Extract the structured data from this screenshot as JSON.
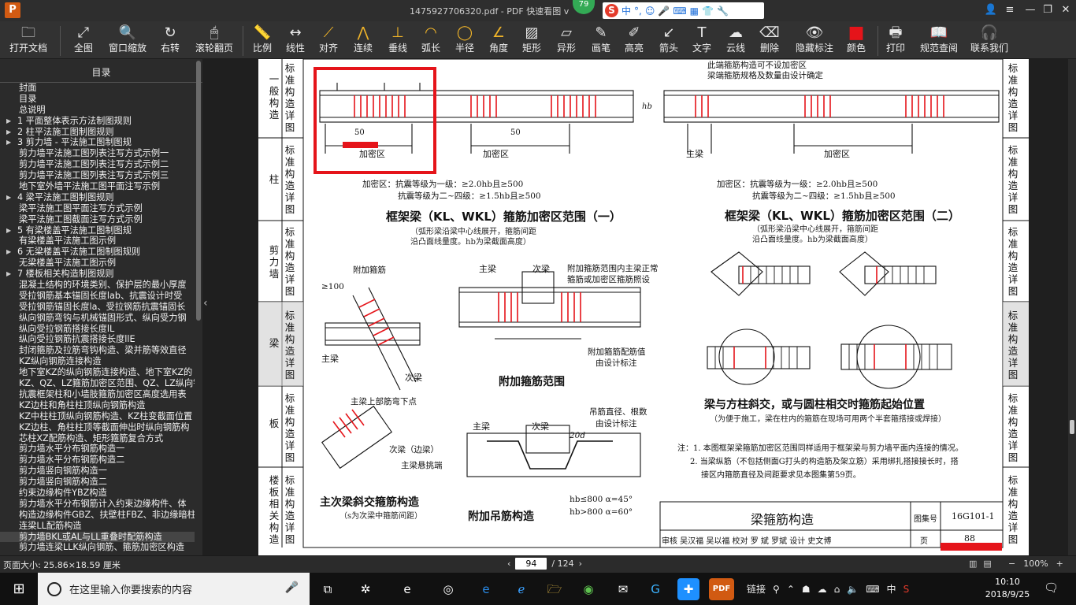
{
  "window": {
    "title": "1475927706320.pdf - PDF 快速看图 v",
    "badge": "79",
    "ime": {
      "lang": "中",
      "punct": "°,"
    }
  },
  "toolbar": [
    {
      "label": "打开文档",
      "icon": "folder-icon",
      "glyph": "🗀"
    },
    {
      "label": "全图",
      "icon": "fit-page-icon",
      "glyph": "⤢"
    },
    {
      "label": "窗口缩放",
      "icon": "zoom-window-icon",
      "glyph": "🔍"
    },
    {
      "label": "右转",
      "icon": "rotate-right-icon",
      "glyph": "↻"
    },
    {
      "label": "滚轮翻页",
      "icon": "mouse-wheel-icon",
      "glyph": "🖱"
    },
    {
      "label": "比例",
      "icon": "scale-icon",
      "glyph": "📏"
    },
    {
      "label": "线性",
      "icon": "linear-measure-icon",
      "glyph": "↔"
    },
    {
      "label": "对齐",
      "icon": "align-measure-icon",
      "glyph": "⟋"
    },
    {
      "label": "连续",
      "icon": "continuous-measure-icon",
      "glyph": "⋀"
    },
    {
      "label": "垂线",
      "icon": "perpendicular-icon",
      "glyph": "⊥"
    },
    {
      "label": "弧长",
      "icon": "arc-length-icon",
      "glyph": "◠"
    },
    {
      "label": "半径",
      "icon": "radius-icon",
      "glyph": "◯"
    },
    {
      "label": "角度",
      "icon": "angle-icon",
      "glyph": "∠"
    },
    {
      "label": "矩形",
      "icon": "rectangle-area-icon",
      "glyph": "▨"
    },
    {
      "label": "异形",
      "icon": "polygon-area-icon",
      "glyph": "▱"
    },
    {
      "label": "画笔",
      "icon": "pen-icon",
      "glyph": "✎"
    },
    {
      "label": "高亮",
      "icon": "highlighter-icon",
      "glyph": "✐"
    },
    {
      "label": "箭头",
      "icon": "arrow-icon",
      "glyph": "↙"
    },
    {
      "label": "文字",
      "icon": "text-icon",
      "glyph": "T"
    },
    {
      "label": "云线",
      "icon": "cloud-line-icon",
      "glyph": "☁"
    },
    {
      "label": "删除",
      "icon": "eraser-icon",
      "glyph": "⌫"
    },
    {
      "label": "隐藏标注",
      "icon": "hide-annotation-icon",
      "glyph": "👁"
    },
    {
      "label": "颜色",
      "icon": "color-swatch-icon",
      "glyph": "■"
    },
    {
      "label": "打印",
      "icon": "printer-icon",
      "glyph": "🖶"
    },
    {
      "label": "规范查阅",
      "icon": "book-icon",
      "glyph": "📖"
    },
    {
      "label": "联系我们",
      "icon": "contact-icon",
      "glyph": "🎧"
    }
  ],
  "colors": {
    "accent": "#e5141a",
    "markup": "#e5141a",
    "toolbar_bg": "#323232"
  },
  "toc": {
    "title": "目录",
    "items": [
      {
        "text": "封面",
        "level": 1,
        "arrow": false
      },
      {
        "text": "目录",
        "level": 1,
        "arrow": false
      },
      {
        "text": "总说明",
        "level": 1,
        "arrow": false
      },
      {
        "text": "1  平面整体表示方法制图规则",
        "level": 1,
        "arrow": true
      },
      {
        "text": "2  柱平法施工图制图规则",
        "level": 1,
        "arrow": true
      },
      {
        "text": "3  剪力墙 - 平法施工图制图规",
        "level": 1,
        "arrow": true
      },
      {
        "text": "剪力墙平法施工图列表注写方式示例一",
        "level": 1,
        "arrow": false
      },
      {
        "text": "剪力墙平法施工图列表注写方式示例二",
        "level": 1,
        "arrow": false
      },
      {
        "text": "剪力墙平法施工图列表注写方式示例三",
        "level": 1,
        "arrow": false
      },
      {
        "text": "地下室外墙平法施工图平面注写示例",
        "level": 1,
        "arrow": false
      },
      {
        "text": "4  梁平法施工图制图规则",
        "level": 1,
        "arrow": true
      },
      {
        "text": "梁平法施工图平面注写方式示例",
        "level": 1,
        "arrow": false
      },
      {
        "text": "梁平法施工图截面注写方式示例",
        "level": 1,
        "arrow": false
      },
      {
        "text": "5  有梁楼盖平法施工图制图规",
        "level": 1,
        "arrow": true
      },
      {
        "text": "有梁楼盖平法施工图示例",
        "level": 1,
        "arrow": false
      },
      {
        "text": "6  无梁楼盖平法施工图制图规则",
        "level": 1,
        "arrow": true
      },
      {
        "text": "无梁楼盖平法施工图示例",
        "level": 1,
        "arrow": false
      },
      {
        "text": "7  楼板相关构造制图规则",
        "level": 1,
        "arrow": true
      },
      {
        "text": "混凝土结构的环境类别、保护层的最小厚度",
        "level": 1,
        "arrow": false
      },
      {
        "text": "受拉钢筋基本锚固长度lab、抗震设计时受",
        "level": 1,
        "arrow": false
      },
      {
        "text": "受拉钢筋锚固长度la、受拉钢筋抗震锚固长",
        "level": 1,
        "arrow": false
      },
      {
        "text": "纵向钢筋弯钩与机械锚固形式、纵向受力钢",
        "level": 1,
        "arrow": false
      },
      {
        "text": "纵向受拉钢筋搭接长度lL",
        "level": 1,
        "arrow": false
      },
      {
        "text": "纵向受拉钢筋抗震搭接长度llE",
        "level": 1,
        "arrow": false
      },
      {
        "text": "封闭箍筋及拉筋弯钩构造、梁并筋等效直径",
        "level": 1,
        "arrow": false
      },
      {
        "text": "KZ纵向钢筋连接构造",
        "level": 1,
        "arrow": false
      },
      {
        "text": "地下室KZ的纵向钢筋连接构造、地下室KZ的",
        "level": 1,
        "arrow": false
      },
      {
        "text": "KZ、QZ、LZ箍筋加密区范围、QZ、LZ纵向钢",
        "level": 1,
        "arrow": false
      },
      {
        "text": "抗震框架柱和小墙肢箍筋加密区高度选用表",
        "level": 1,
        "arrow": false
      },
      {
        "text": "KZ边柱和角柱柱顶纵向钢筋构造",
        "level": 1,
        "arrow": false
      },
      {
        "text": "KZ中柱柱顶纵向钢筋构造、KZ柱变截面位置",
        "level": 1,
        "arrow": false
      },
      {
        "text": "KZ边柱、角柱柱顶等截面伸出时纵向钢筋构",
        "level": 1,
        "arrow": false
      },
      {
        "text": "芯柱XZ配筋构造、矩形箍筋复合方式",
        "level": 1,
        "arrow": false
      },
      {
        "text": "剪力墙水平分布钢筋构造一",
        "level": 1,
        "arrow": false
      },
      {
        "text": "剪力墙水平分布钢筋构造二",
        "level": 1,
        "arrow": false
      },
      {
        "text": "剪力墙竖向钢筋构造一",
        "level": 1,
        "arrow": false
      },
      {
        "text": "剪力墙竖向钢筋构造二",
        "level": 1,
        "arrow": false
      },
      {
        "text": "约束边缘构件YBZ构造",
        "level": 1,
        "arrow": false
      },
      {
        "text": "剪力墙水平分布钢筋计入约束边缘构件、体",
        "level": 1,
        "arrow": false
      },
      {
        "text": "构造边缘构件GBZ、扶壁柱FBZ、非边缘暗柱",
        "level": 1,
        "arrow": false
      },
      {
        "text": "连梁LL配筋构造",
        "level": 1,
        "arrow": false
      },
      {
        "text": "剪力墙BKL或AL与LL重叠时配筋构造",
        "level": 1,
        "arrow": false,
        "selected": true
      },
      {
        "text": "剪力墙连梁LLK纵向钢筋、箍筋加密区构造",
        "level": 1,
        "arrow": false
      }
    ]
  },
  "document": {
    "left_tabs": [
      "一般构造",
      "标准构造详图",
      "柱",
      "标准构造详图",
      "剪力墙",
      "标准构造详图",
      "梁",
      "标准构造详图",
      "板",
      "标准构造详图",
      "楼板相关构造",
      "标准构造详图"
    ],
    "right_tabs": [
      "标准构造详图",
      "一般构造",
      "标准构造详图",
      "柱",
      "标准构造详图",
      "剪力墙",
      "标准构造详图",
      "梁",
      "标准构造详图",
      "板",
      "标准构造详图",
      "楼板相关构造"
    ],
    "diagram1": {
      "title": "框架梁（KL、WKL）箍筋加密区范围（一）",
      "sub1": "（弧形梁沿梁中心线展开，箍筋间距",
      "sub2": "沿凸面线量度。hb为梁截面高度）",
      "note1": "加密区：抗震等级为一级：≥2.0hb且≥500",
      "note2": "抗震等级为二~四级：≥1.5hb且≥500",
      "dense": "加密区",
      "dim": "50",
      "hb": "hb"
    },
    "diagram2": {
      "title": "框架梁（KL、WKL）箍筋加密区范围（二）",
      "sub1": "（弧形梁沿梁中心线展开，箍筋间距",
      "sub2": "沿凸面线量度。hb为梁截面高度）",
      "top1": "此端箍筋构造可不设加密区",
      "top2": "梁端箍筋规格及数量由设计确定",
      "note1": "加密区：抗震等级为一级：≥2.0hb且≥500",
      "note2": "抗震等级为二~四级：≥1.5hb且≥500",
      "main": "主梁",
      "dense": "加密区"
    },
    "diagram3": {
      "title": "主次梁斜交箍筋构造",
      "sub": "（s为次梁中箍筋间距）",
      "main": "主梁",
      "sec": "次梁",
      "add": "附加箍筋",
      "d100": "≥100",
      "top": "主梁上部筋弯下点",
      "sec2": "次梁（边梁）",
      "cant": "主梁悬挑端",
      "s50": "50"
    },
    "diagram4": {
      "title": "附加箍筋范围",
      "main": "主梁",
      "sec": "次梁",
      "note1": "附加箍筋范围内主梁正常",
      "note2": "箍筋或加密区箍筋照设",
      "val1": "附加箍筋配筋值",
      "val2": "由设计标注",
      "b": "b",
      "h1": "h1"
    },
    "diagram5": {
      "title": "附加吊筋构造",
      "main": "主梁",
      "sec": "次梁",
      "note1": "吊筋直径、根数",
      "note2": "由设计标注",
      "d20": "20d",
      "c1": "hb≤800  α=45°",
      "c2": "hb>800  α=60°",
      "alpha": "α"
    },
    "diagram6": {
      "title": "梁与方柱斜交，或与圆柱相交时箍筋起始位置",
      "sub": "（为便于施工，梁在柱内的箍筋在现场可用两个半套箍搭接或焊接）"
    },
    "notes": {
      "n1": "注：1. 本图框架梁箍筋加密区范围同样适用于框架梁与剪力墙平面内连接的情况。",
      "n2": "2. 当梁纵筋（不包括侧面G打头的构造筋及架立筋）采用绑扎搭接接长时，搭",
      "n3": "接区内箍筋直径及间距要求见本图集第59页。"
    },
    "titleblock": {
      "name": "梁箍筋构造",
      "set_label": "图集号",
      "set": "16G101-1",
      "page_label": "页",
      "page": "88",
      "row": "审核  吴汉福  吴以福  校对  罗  斌    罗斌   设计  史文博"
    }
  },
  "status": {
    "page_size": "页面大小: 25.86×18.59 厘米",
    "page": "94",
    "total": "/ 124",
    "zoom": "100%"
  },
  "taskbar": {
    "search_placeholder": "在这里输入你要搜索的内容",
    "link": "链接",
    "time": "10:10",
    "date": "2018/9/25",
    "ime": "中"
  }
}
